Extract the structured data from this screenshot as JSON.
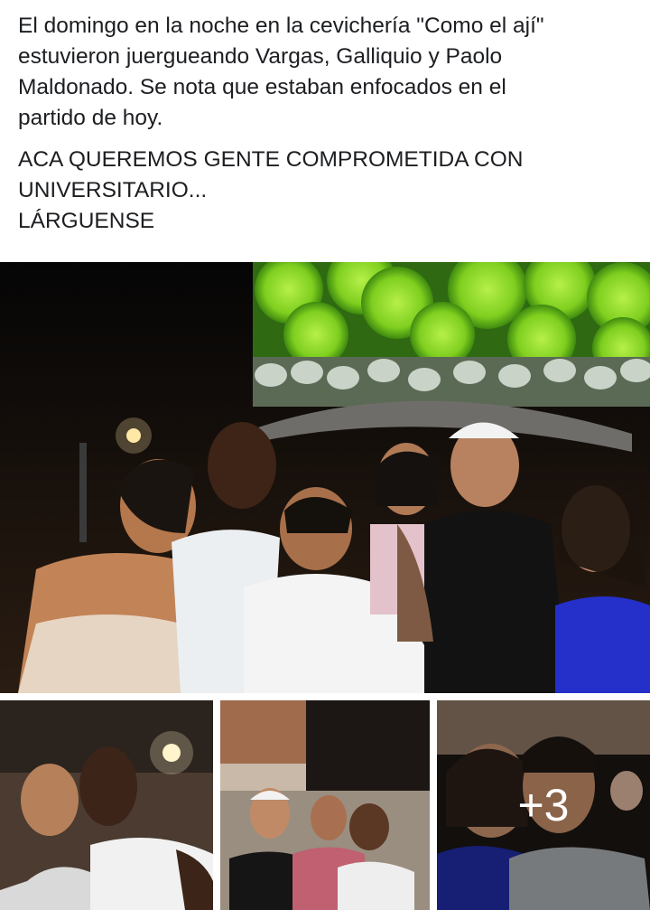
{
  "post": {
    "paragraph1": [
      "El domingo en la noche en la cevichería \"Como el ají\"",
      "estuvieron juergueando Vargas, Galliquio y Paolo",
      "Maldonado. Se nota que estaban enfocados en el",
      "partido de hoy."
    ],
    "paragraph2": [
      "ACA QUEREMOS GENTE COMPROMETIDA CON",
      "UNIVERSITARIO...",
      "LÁRGUENSE"
    ]
  },
  "gallery": {
    "more_count_label": "+3"
  }
}
